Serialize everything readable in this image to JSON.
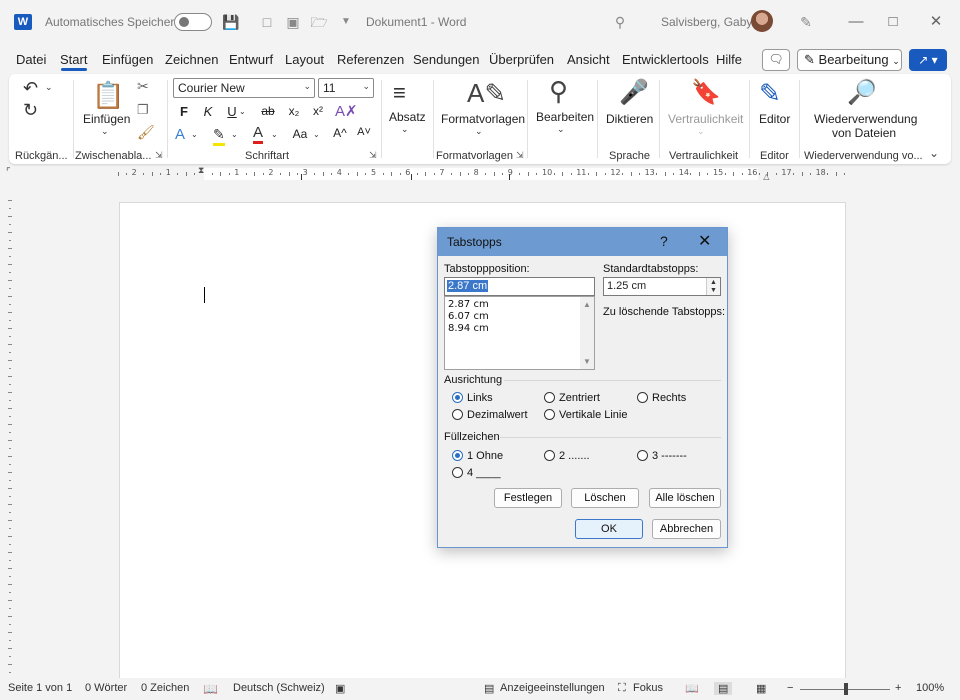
{
  "titlebar": {
    "autosave_label": "Automatisches Speichern",
    "document_title": "Dokument1 - Word",
    "user_name": "Salvisberg, Gaby"
  },
  "menu": {
    "tabs": [
      "Datei",
      "Start",
      "Einfügen",
      "Zeichnen",
      "Entwurf",
      "Layout",
      "Referenzen",
      "Sendungen",
      "Überprüfen",
      "Ansicht",
      "Entwicklertools",
      "Hilfe"
    ],
    "active_tab": "Start",
    "edit_mode_label": "Bearbeitung"
  },
  "ribbon": {
    "groups": {
      "undo": "Rückgän...",
      "clipboard": "Zwischenabla...",
      "font": "Schriftart",
      "styles": "Formatvorlagen",
      "voice": "Sprache",
      "sensitivity": "Vertraulichkeit",
      "editor": "Editor",
      "reuse": "Wiederverwendung vo..."
    },
    "paste_label": "Einfügen",
    "font_name": "Courier New",
    "font_size": "11",
    "paragraph_label": "Absatz",
    "styles_label": "Formatvorlagen",
    "editing_label": "Bearbeiten",
    "dictate_label": "Diktieren",
    "sensitivity_label": "Vertraulichkeit",
    "editor_label": "Editor",
    "reuse_label_1": "Wiederverwendung",
    "reuse_label_2": "von Dateien",
    "bold": "F",
    "italic": "K",
    "underline": "U",
    "strike": "ab",
    "subscript": "x₂",
    "superscript": "x²",
    "change_case": "Aa",
    "grow": "A^",
    "shrink": "A˅"
  },
  "ruler": {
    "numbers": [
      "2",
      "1",
      "1",
      "2",
      "3",
      "4",
      "5",
      "6",
      "7",
      "8",
      "9",
      "10",
      "11",
      "12",
      "13",
      "14",
      "15",
      "16",
      "17",
      "18"
    ]
  },
  "statusbar": {
    "page": "Seite 1 von 1",
    "words": "0 Wörter",
    "chars": "0 Zeichen",
    "language": "Deutsch (Schweiz)",
    "display_settings": "Anzeigeeinstellungen",
    "focus": "Fokus",
    "zoom": "100%",
    "zoom_minus": "−",
    "zoom_plus": "+"
  },
  "dialog": {
    "title": "Tabstopps",
    "help": "?",
    "close": "✕",
    "position_label": "Tabstoppposition:",
    "position_value": "2.87 cm",
    "positions": [
      "2.87 cm",
      "6.07 cm",
      "8.94 cm"
    ],
    "default_label": "Standardtabstopps:",
    "default_value": "1.25 cm",
    "to_clear_label": "Zu löschende Tabstopps:",
    "alignment_label": "Ausrichtung",
    "alignment": {
      "left": "Links",
      "center": "Zentriert",
      "right": "Rechts",
      "decimal": "Dezimalwert",
      "bar": "Vertikale Linie"
    },
    "leader_label": "Füllzeichen",
    "leader": {
      "one": "1 Ohne",
      "two": "2 .......",
      "three": "3 -------",
      "four": "4 ____"
    },
    "set_button": "Festlegen",
    "clear_button": "Löschen",
    "clear_all_button": "Alle löschen",
    "ok_button": "OK",
    "cancel_button": "Abbrechen"
  }
}
